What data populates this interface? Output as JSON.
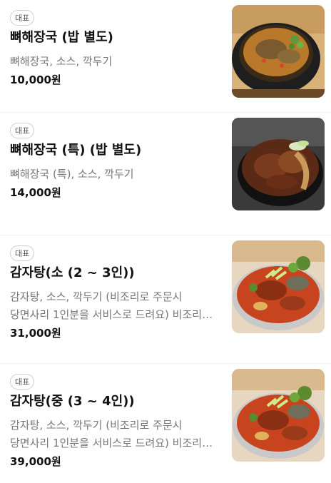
{
  "menu": {
    "items": [
      {
        "badge": "대표",
        "name": "뼈해장국 (밥 별도)",
        "description": "뼈해장국, 소스, 깍두기",
        "price": "10,000원",
        "image_icon": "soup-bowl-icon"
      },
      {
        "badge": "대표",
        "name": "뼈해장국 (특) (밥 별도)",
        "description": "뼈해장국 (특), 소스, 깍두기",
        "price": "14,000원",
        "image_icon": "pork-bone-stew-icon"
      },
      {
        "badge": "대표",
        "name": "감자탕(소 (2 ~ 3인))",
        "description": "감자탕, 소스, 깍두기 (비조리로 주문시 당면사리 1인분을 서비스로 드려요) 비조리로 주문시 빠르게 드실 수 있어요",
        "price": "31,000원",
        "image_icon": "gamjatang-pot-icon"
      },
      {
        "badge": "대표",
        "name": "감자탕(중 (3 ~ 4인))",
        "description": "감자탕, 소스, 깍두기 (비조리로 주문시 당면사리 1인분을 서비스로 드려요) 비조리로 주문시 빠르게 드실 수 있어요",
        "price": "39,000원",
        "image_icon": "gamjatang-pot-icon"
      }
    ]
  }
}
